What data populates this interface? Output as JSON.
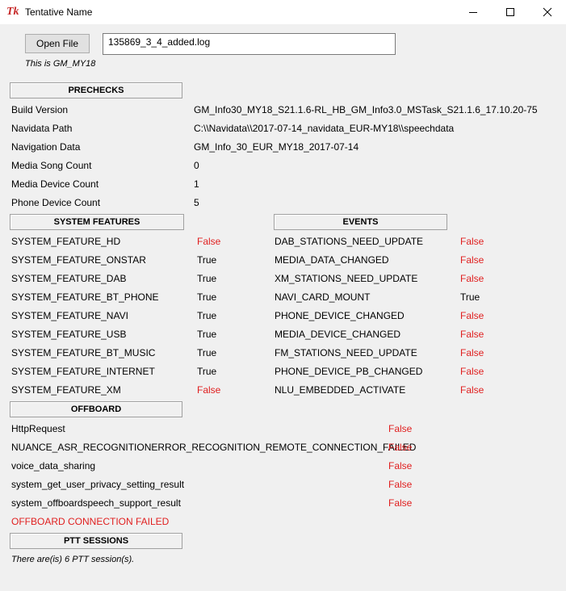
{
  "window": {
    "title": "Tentative Name",
    "logo_text": "Tk"
  },
  "toolbar": {
    "open_file_label": "Open File",
    "file_value": "135869_3_4_added.log",
    "model_note": "This is GM_MY18"
  },
  "prechecks": {
    "header": "PRECHECKS",
    "rows": [
      {
        "label": "Build Version",
        "value": "GM_Info30_MY18_S21.1.6-RL_HB_GM_Info3.0_MSTask_S21.1.6_17.10.20-75"
      },
      {
        "label": "Navidata Path",
        "value": "C:\\\\Navidata\\\\2017-07-14_navidata_EUR-MY18\\\\speechdata"
      },
      {
        "label": "Navigation Data",
        "value": "GM_Info_30_EUR_MY18_2017-07-14"
      },
      {
        "label": "Media Song Count",
        "value": "0"
      },
      {
        "label": "Media Device Count",
        "value": "1"
      },
      {
        "label": "Phone Device Count",
        "value": "5"
      }
    ]
  },
  "system_features": {
    "header": "SYSTEM FEATURES",
    "rows": [
      {
        "name": "SYSTEM_FEATURE_HD",
        "value": "False"
      },
      {
        "name": "SYSTEM_FEATURE_ONSTAR",
        "value": "True"
      },
      {
        "name": "SYSTEM_FEATURE_DAB",
        "value": "True"
      },
      {
        "name": "SYSTEM_FEATURE_BT_PHONE",
        "value": "True"
      },
      {
        "name": "SYSTEM_FEATURE_NAVI",
        "value": "True"
      },
      {
        "name": "SYSTEM_FEATURE_USB",
        "value": "True"
      },
      {
        "name": "SYSTEM_FEATURE_BT_MUSIC",
        "value": "True"
      },
      {
        "name": "SYSTEM_FEATURE_INTERNET",
        "value": "True"
      },
      {
        "name": "SYSTEM_FEATURE_XM",
        "value": "False"
      }
    ]
  },
  "events": {
    "header": "EVENTS",
    "rows": [
      {
        "name": "DAB_STATIONS_NEED_UPDATE",
        "value": "False"
      },
      {
        "name": "MEDIA_DATA_CHANGED",
        "value": "False"
      },
      {
        "name": "XM_STATIONS_NEED_UPDATE",
        "value": "False"
      },
      {
        "name": "NAVI_CARD_MOUNT",
        "value": "True"
      },
      {
        "name": "PHONE_DEVICE_CHANGED",
        "value": "False"
      },
      {
        "name": "MEDIA_DEVICE_CHANGED",
        "value": "False"
      },
      {
        "name": "FM_STATIONS_NEED_UPDATE",
        "value": "False"
      },
      {
        "name": "PHONE_DEVICE_PB_CHANGED",
        "value": "False"
      },
      {
        "name": "NLU_EMBEDDED_ACTIVATE",
        "value": "False"
      }
    ]
  },
  "offboard": {
    "header": "OFFBOARD",
    "rows": [
      {
        "name": "HttpRequest",
        "value": "False"
      },
      {
        "name": "NUANCE_ASR_RECOGNITIONERROR_RECOGNITION_REMOTE_CONNECTION_FAILED",
        "value": "False"
      },
      {
        "name": "voice_data_sharing",
        "value": "False"
      },
      {
        "name": "system_get_user_privacy_setting_result",
        "value": "False"
      },
      {
        "name": "system_offboardspeech_support_result",
        "value": "False"
      }
    ],
    "status": "OFFBOARD CONNECTION FAILED"
  },
  "ptt": {
    "header": "PTT SESSIONS",
    "summary": "There are(is) 6 PTT session(s)."
  },
  "colors": {
    "false_value": "#e01f1f",
    "true_value": "#000000",
    "status_error": "#e01f1f"
  }
}
